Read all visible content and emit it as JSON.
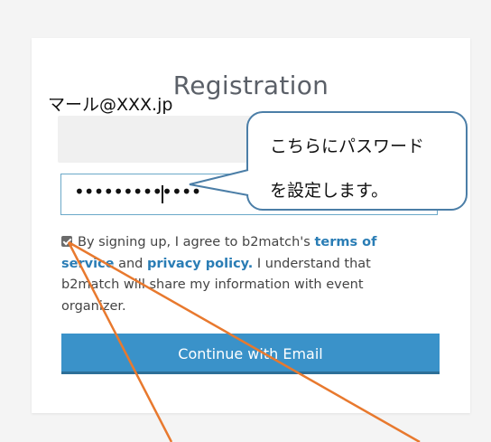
{
  "registration": {
    "title": "Registration",
    "email_value": "マール@XXX.jp",
    "password_value": "•••••••••••••",
    "terms": {
      "pre": "By signing up, I agree to b2match's ",
      "terms_link": "terms of service",
      "and": " and ",
      "privacy_link": "privacy policy.",
      "post": " I understand that b2match will share my information with event organizer."
    },
    "continue_label": "Continue with Email"
  },
  "callout": {
    "line1": "こちらにパスワード",
    "line2": "を設定します。"
  },
  "colors": {
    "accent": "#3a92c9",
    "link": "#2a7db5",
    "annotation_arrow": "#e8792e",
    "callout_border": "#4b7ea7"
  }
}
